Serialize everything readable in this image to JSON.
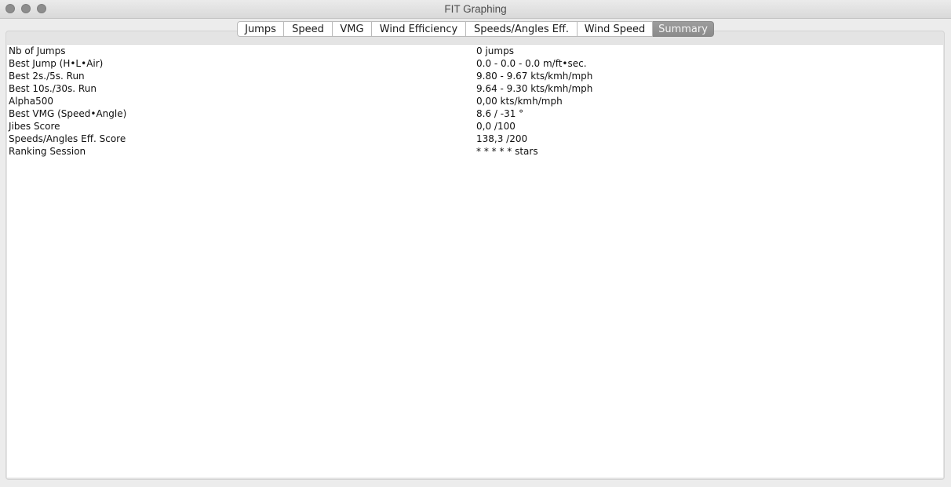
{
  "window": {
    "title": "FIT Graphing"
  },
  "tabs": [
    {
      "label": "Jumps",
      "selected": false
    },
    {
      "label": "Speed",
      "selected": false
    },
    {
      "label": "VMG",
      "selected": false
    },
    {
      "label": "Wind Efficiency",
      "selected": false
    },
    {
      "label": "Speeds/Angles Eff.",
      "selected": false
    },
    {
      "label": "Wind Speed",
      "selected": false
    },
    {
      "label": "Summary",
      "selected": true
    }
  ],
  "summary": {
    "rows": [
      {
        "label": "Nb of Jumps",
        "value": "0 jumps"
      },
      {
        "label": "Best Jump (H•L•Air)",
        "value": "0.0 - 0.0 - 0.0 m/ft•sec."
      },
      {
        "label": "Best 2s./5s. Run",
        "value": "9.80 - 9.67 kts/kmh/mph"
      },
      {
        "label": "Best 10s./30s. Run",
        "value": "9.64 - 9.30 kts/kmh/mph"
      },
      {
        "label": "Alpha500",
        "value": "0,00 kts/kmh/mph"
      },
      {
        "label": "Best VMG (Speed•Angle)",
        "value": "8.6 / -31 °"
      },
      {
        "label": "Jibes Score",
        "value": "0,0 /100"
      },
      {
        "label": "Speeds/Angles Eff. Score",
        "value": "138,3 /200"
      },
      {
        "label": "Ranking Session",
        "value": "* * * * * stars"
      }
    ]
  }
}
